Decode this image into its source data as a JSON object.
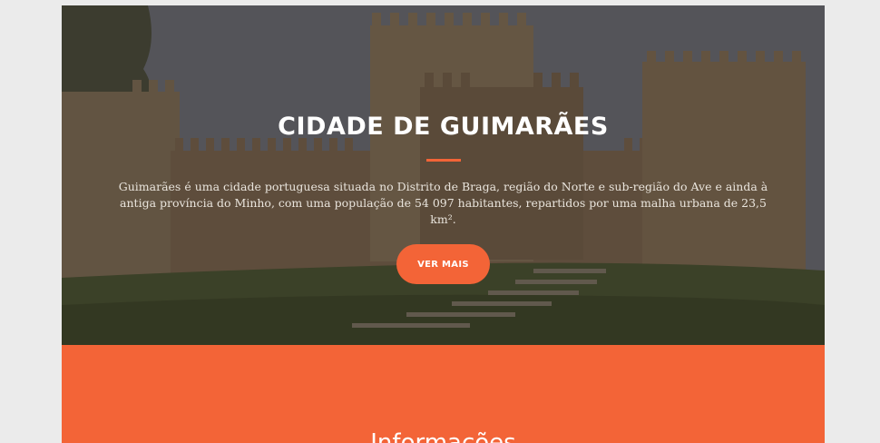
{
  "hero": {
    "title": "CIDADE DE GUIMARÃES",
    "description": "Guimarães é uma cidade portuguesa situada no Distrito de Braga, região do Norte e sub-região do Ave e ainda à antiga província do Minho, com uma população de 54 097 habitantes, repartidos por uma malha urbana de 23,5 km².",
    "button_label": "VER MAIS",
    "background_image": "castle-background"
  },
  "info": {
    "title": "Informações"
  },
  "colors": {
    "accent": "#f36437",
    "page_background": "#ebebeb",
    "text_light": "#ffffff"
  }
}
